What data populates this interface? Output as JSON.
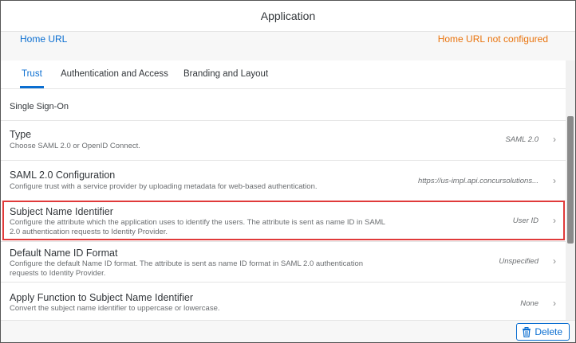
{
  "window": {
    "title": "Application"
  },
  "home": {
    "link_label": "Home URL",
    "status": "Home URL not configured"
  },
  "tabs": [
    {
      "label": "Trust",
      "active": true
    },
    {
      "label": "Authentication and Access",
      "active": false
    },
    {
      "label": "Branding and Layout",
      "active": false
    }
  ],
  "section": {
    "title": "Single Sign-On"
  },
  "rows": [
    {
      "title": "Type",
      "description": "Choose SAML 2.0 or OpenID Connect.",
      "value": "SAML 2.0"
    },
    {
      "title": "SAML 2.0 Configuration",
      "description": "Configure trust with a service provider by uploading metadata for web-based authentication.",
      "value": "https://us-impl.api.concursolutions..."
    },
    {
      "title": "Subject Name Identifier",
      "description": "Configure the attribute which the application uses to identify the users. The attribute is sent as name ID in SAML 2.0 authentication requests to Identity Provider.",
      "value": "User ID",
      "highlighted": true
    },
    {
      "title": "Default Name ID Format",
      "description": "Configure the default Name ID format. The attribute is sent as name ID format in SAML 2.0 authentication requests to Identity Provider.",
      "value": "Unspecified"
    },
    {
      "title": "Apply Function to Subject Name Identifier",
      "description": "Convert the subject name identifier to uppercase or lowercase.",
      "value": "None"
    }
  ],
  "footer": {
    "delete_label": "Delete"
  },
  "icons": {
    "chevron": "chevron-right-icon",
    "delete": "trash-icon"
  },
  "colors": {
    "accent": "#0a6ed1",
    "warning": "#e9730c",
    "highlight": "#e03a3a"
  }
}
